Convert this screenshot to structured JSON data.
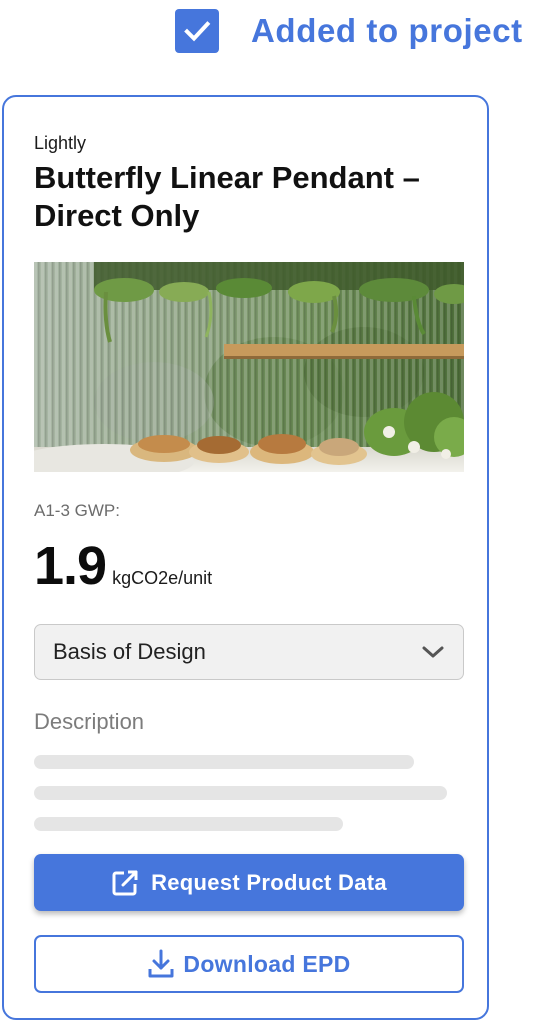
{
  "confirmation": {
    "label": "Added to project",
    "checked": true
  },
  "product": {
    "brand": "Lightly",
    "title": "Butterfly Linear Pendant – Direct Only"
  },
  "gwp": {
    "label": "A1-3 GWP:",
    "value": "1.9",
    "unit": "kgCO2e/unit"
  },
  "design_select": {
    "selected": "Basis of Design"
  },
  "description": {
    "heading": "Description"
  },
  "actions": {
    "request_label": "Request Product Data",
    "download_label": "Download EPD"
  },
  "colors": {
    "accent": "#4676dc",
    "select_bg": "#f1f1f1",
    "skeleton": "#e5e5e5"
  },
  "icons": {
    "checkbox": "check-icon",
    "dropdown": "chevron-down-icon",
    "request": "external-link-icon",
    "download": "download-icon"
  }
}
